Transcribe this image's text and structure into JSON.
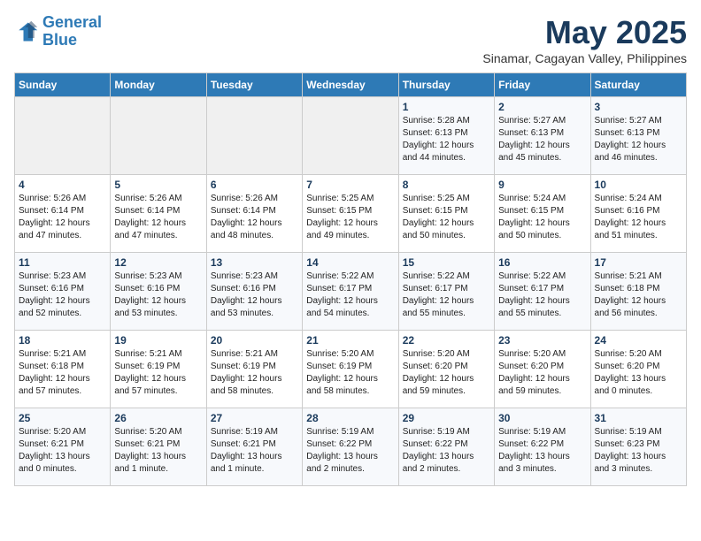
{
  "logo": {
    "line1": "General",
    "line2": "Blue"
  },
  "title": "May 2025",
  "subtitle": "Sinamar, Cagayan Valley, Philippines",
  "weekdays": [
    "Sunday",
    "Monday",
    "Tuesday",
    "Wednesday",
    "Thursday",
    "Friday",
    "Saturday"
  ],
  "weeks": [
    [
      {
        "day": "",
        "info": ""
      },
      {
        "day": "",
        "info": ""
      },
      {
        "day": "",
        "info": ""
      },
      {
        "day": "",
        "info": ""
      },
      {
        "day": "1",
        "info": "Sunrise: 5:28 AM\nSunset: 6:13 PM\nDaylight: 12 hours\nand 44 minutes."
      },
      {
        "day": "2",
        "info": "Sunrise: 5:27 AM\nSunset: 6:13 PM\nDaylight: 12 hours\nand 45 minutes."
      },
      {
        "day": "3",
        "info": "Sunrise: 5:27 AM\nSunset: 6:13 PM\nDaylight: 12 hours\nand 46 minutes."
      }
    ],
    [
      {
        "day": "4",
        "info": "Sunrise: 5:26 AM\nSunset: 6:14 PM\nDaylight: 12 hours\nand 47 minutes."
      },
      {
        "day": "5",
        "info": "Sunrise: 5:26 AM\nSunset: 6:14 PM\nDaylight: 12 hours\nand 47 minutes."
      },
      {
        "day": "6",
        "info": "Sunrise: 5:26 AM\nSunset: 6:14 PM\nDaylight: 12 hours\nand 48 minutes."
      },
      {
        "day": "7",
        "info": "Sunrise: 5:25 AM\nSunset: 6:15 PM\nDaylight: 12 hours\nand 49 minutes."
      },
      {
        "day": "8",
        "info": "Sunrise: 5:25 AM\nSunset: 6:15 PM\nDaylight: 12 hours\nand 50 minutes."
      },
      {
        "day": "9",
        "info": "Sunrise: 5:24 AM\nSunset: 6:15 PM\nDaylight: 12 hours\nand 50 minutes."
      },
      {
        "day": "10",
        "info": "Sunrise: 5:24 AM\nSunset: 6:16 PM\nDaylight: 12 hours\nand 51 minutes."
      }
    ],
    [
      {
        "day": "11",
        "info": "Sunrise: 5:23 AM\nSunset: 6:16 PM\nDaylight: 12 hours\nand 52 minutes."
      },
      {
        "day": "12",
        "info": "Sunrise: 5:23 AM\nSunset: 6:16 PM\nDaylight: 12 hours\nand 53 minutes."
      },
      {
        "day": "13",
        "info": "Sunrise: 5:23 AM\nSunset: 6:16 PM\nDaylight: 12 hours\nand 53 minutes."
      },
      {
        "day": "14",
        "info": "Sunrise: 5:22 AM\nSunset: 6:17 PM\nDaylight: 12 hours\nand 54 minutes."
      },
      {
        "day": "15",
        "info": "Sunrise: 5:22 AM\nSunset: 6:17 PM\nDaylight: 12 hours\nand 55 minutes."
      },
      {
        "day": "16",
        "info": "Sunrise: 5:22 AM\nSunset: 6:17 PM\nDaylight: 12 hours\nand 55 minutes."
      },
      {
        "day": "17",
        "info": "Sunrise: 5:21 AM\nSunset: 6:18 PM\nDaylight: 12 hours\nand 56 minutes."
      }
    ],
    [
      {
        "day": "18",
        "info": "Sunrise: 5:21 AM\nSunset: 6:18 PM\nDaylight: 12 hours\nand 57 minutes."
      },
      {
        "day": "19",
        "info": "Sunrise: 5:21 AM\nSunset: 6:19 PM\nDaylight: 12 hours\nand 57 minutes."
      },
      {
        "day": "20",
        "info": "Sunrise: 5:21 AM\nSunset: 6:19 PM\nDaylight: 12 hours\nand 58 minutes."
      },
      {
        "day": "21",
        "info": "Sunrise: 5:20 AM\nSunset: 6:19 PM\nDaylight: 12 hours\nand 58 minutes."
      },
      {
        "day": "22",
        "info": "Sunrise: 5:20 AM\nSunset: 6:20 PM\nDaylight: 12 hours\nand 59 minutes."
      },
      {
        "day": "23",
        "info": "Sunrise: 5:20 AM\nSunset: 6:20 PM\nDaylight: 12 hours\nand 59 minutes."
      },
      {
        "day": "24",
        "info": "Sunrise: 5:20 AM\nSunset: 6:20 PM\nDaylight: 13 hours\nand 0 minutes."
      }
    ],
    [
      {
        "day": "25",
        "info": "Sunrise: 5:20 AM\nSunset: 6:21 PM\nDaylight: 13 hours\nand 0 minutes."
      },
      {
        "day": "26",
        "info": "Sunrise: 5:20 AM\nSunset: 6:21 PM\nDaylight: 13 hours\nand 1 minute."
      },
      {
        "day": "27",
        "info": "Sunrise: 5:19 AM\nSunset: 6:21 PM\nDaylight: 13 hours\nand 1 minute."
      },
      {
        "day": "28",
        "info": "Sunrise: 5:19 AM\nSunset: 6:22 PM\nDaylight: 13 hours\nand 2 minutes."
      },
      {
        "day": "29",
        "info": "Sunrise: 5:19 AM\nSunset: 6:22 PM\nDaylight: 13 hours\nand 2 minutes."
      },
      {
        "day": "30",
        "info": "Sunrise: 5:19 AM\nSunset: 6:22 PM\nDaylight: 13 hours\nand 3 minutes."
      },
      {
        "day": "31",
        "info": "Sunrise: 5:19 AM\nSunset: 6:23 PM\nDaylight: 13 hours\nand 3 minutes."
      }
    ]
  ]
}
